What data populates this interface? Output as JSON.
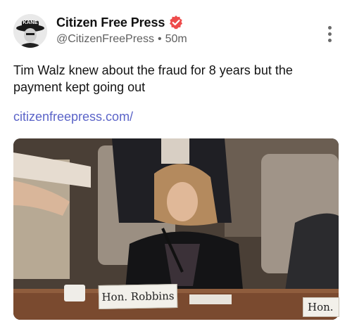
{
  "post": {
    "author": {
      "display_name": "Citizen Free Press",
      "handle": "@CitizenFreePress",
      "time_ago": "50m",
      "separator": "•",
      "verified": true,
      "avatar_text": "KANE"
    },
    "more_icon": "more-vertical-icon",
    "text": "Tim Walz knew about the fraud for 8 years but the payment kept going out",
    "link_text": "citizenfreepress.com/",
    "media": {
      "nameplate_primary": "Hon. Robbins",
      "nameplate_secondary": "Hon."
    }
  },
  "colors": {
    "verified_badge": "#ee4b4b",
    "link": "#5b64c8",
    "secondary_text": "#5f5f5f"
  }
}
